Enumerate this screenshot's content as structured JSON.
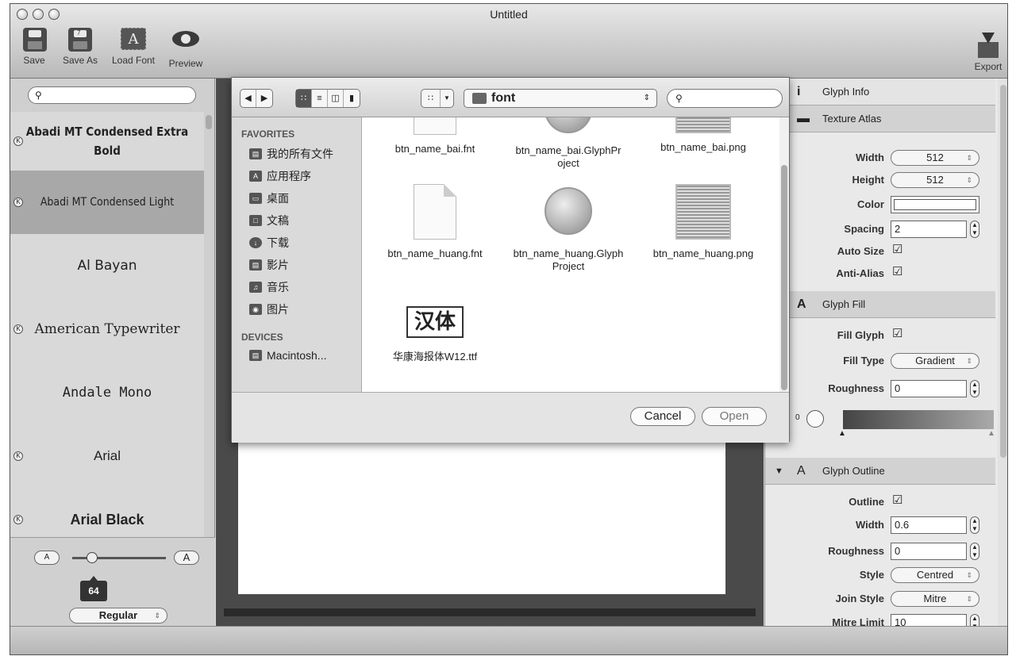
{
  "window": {
    "title": "Untitled"
  },
  "toolbar": {
    "save": "Save",
    "save_as": "Save As",
    "load_font": "Load Font",
    "preview": "Preview",
    "export": "Export"
  },
  "sidebar": {
    "search_placeholder": "",
    "fonts": [
      {
        "name": "Abadi MT Condensed Extra Bold",
        "selected": false
      },
      {
        "name": "Abadi MT Condensed Light",
        "selected": true
      },
      {
        "name": "Al Bayan",
        "selected": false
      },
      {
        "name": "American Typewriter",
        "selected": false
      },
      {
        "name": "Andale Mono",
        "selected": false
      },
      {
        "name": "Arial",
        "selected": false
      },
      {
        "name": "Arial Black",
        "selected": false
      }
    ],
    "size_small_label": "A",
    "size_large_label": "A",
    "font_size": "64",
    "style": "Regular"
  },
  "dialog": {
    "path": "font",
    "search_placeholder": "",
    "favorites_header": "FAVORITES",
    "favorites": [
      "我的所有文件",
      "应用程序",
      "桌面",
      "文稿",
      "下载",
      "影片",
      "音乐",
      "图片"
    ],
    "devices_header": "DEVICES",
    "devices": [
      "Macintosh..."
    ],
    "files": [
      {
        "name": "btn_name_bai.fnt",
        "kind": "doc"
      },
      {
        "name": "btn_name_bai.GlyphProject",
        "kind": "glyphproject"
      },
      {
        "name": "btn_name_bai.png",
        "kind": "png"
      },
      {
        "name": "btn_name_huang.fnt",
        "kind": "doc"
      },
      {
        "name": "btn_name_huang.GlyphProject",
        "kind": "glyphproject"
      },
      {
        "name": "btn_name_huang.png",
        "kind": "png"
      },
      {
        "name": "华康海报体W12.ttf",
        "kind": "ttf",
        "preview": "汉体"
      }
    ],
    "cancel": "Cancel",
    "open": "Open"
  },
  "panel": {
    "glyph_info": "Glyph Info",
    "texture_atlas": "Texture Atlas",
    "width_label": "Width",
    "width_value": "512",
    "height_label": "Height",
    "height_value": "512",
    "color_label": "Color",
    "spacing_label": "Spacing",
    "spacing_value": "2",
    "auto_size_label": "Auto Size",
    "anti_alias_label": "Anti-Alias",
    "glyph_fill": "Glyph Fill",
    "fill_glyph_label": "Fill Glyph",
    "fill_type_label": "Fill Type",
    "fill_type_value": "Gradient",
    "fill_roughness_label": "Roughness",
    "fill_roughness_value": "0",
    "gradient_angle": "0",
    "glyph_outline": "Glyph Outline",
    "outline_label": "Outline",
    "outline_width_label": "Width",
    "outline_width_value": "0.6",
    "outline_roughness_label": "Roughness",
    "outline_roughness_value": "0",
    "style_label": "Style",
    "style_value": "Centred",
    "join_style_label": "Join Style",
    "join_style_value": "Mitre",
    "mitre_limit_label": "Mitre Limit",
    "mitre_limit_value": "10"
  }
}
